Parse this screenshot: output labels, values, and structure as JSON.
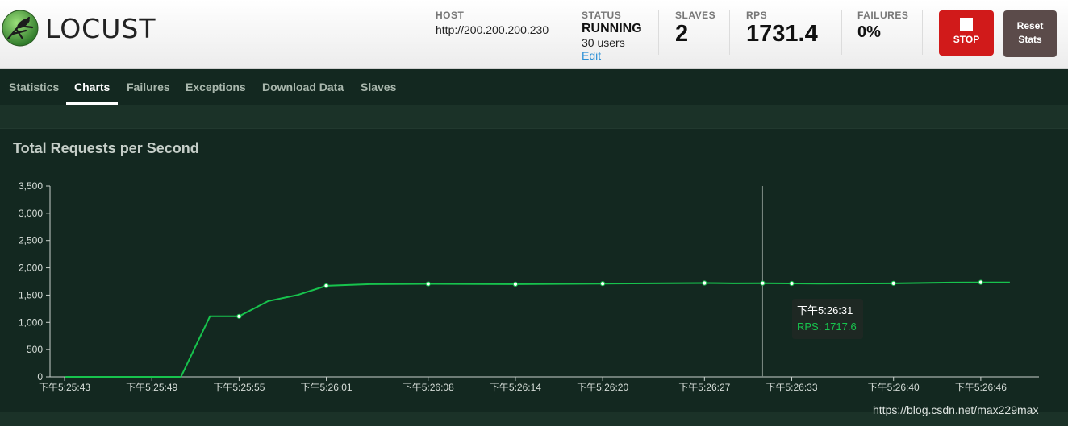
{
  "header": {
    "logo_text": "LOCUST",
    "host": {
      "label": "HOST",
      "value": "http://200.200.200.230"
    },
    "status": {
      "label": "STATUS",
      "value": "RUNNING",
      "users": "30 users",
      "edit": "Edit"
    },
    "slaves": {
      "label": "SLAVES",
      "value": "2"
    },
    "rps": {
      "label": "RPS",
      "value": "1731.4"
    },
    "failures": {
      "label": "FAILURES",
      "value": "0%"
    },
    "stop_label": "STOP",
    "reset_line1": "Reset",
    "reset_line2": "Stats"
  },
  "tabs": [
    "Statistics",
    "Charts",
    "Failures",
    "Exceptions",
    "Download Data",
    "Slaves"
  ],
  "active_tab": "Charts",
  "chart_data": {
    "type": "line",
    "title": "Total Requests per Second",
    "xlabel": "",
    "ylabel": "",
    "ylim": [
      0,
      3500
    ],
    "y_ticks": [
      0,
      500,
      1000,
      1500,
      2000,
      2500,
      3000,
      3500
    ],
    "y_tick_labels": [
      "0",
      "500",
      "1,000",
      "1,500",
      "2,000",
      "2,500",
      "3,000",
      "3,500"
    ],
    "x_tick_labels": [
      "下午5:25:43",
      "下午5:25:49",
      "下午5:25:55",
      "下午5:26:01",
      "下午5:26:08",
      "下午5:26:14",
      "下午5:26:20",
      "下午5:26:27",
      "下午5:26:33",
      "下午5:26:40",
      "下午5:26:46"
    ],
    "x_range": [
      "5:25:42",
      "5:26:50"
    ],
    "series": [
      {
        "name": "RPS",
        "color": "#17c34d",
        "points": [
          [
            "5:25:43",
            0
          ],
          [
            "5:25:46",
            0
          ],
          [
            "5:25:49",
            0
          ],
          [
            "5:25:51",
            0
          ],
          [
            "5:25:53",
            1110
          ],
          [
            "5:25:55",
            1110
          ],
          [
            "5:25:57",
            1390
          ],
          [
            "5:25:59",
            1500
          ],
          [
            "5:26:01",
            1670
          ],
          [
            "5:26:04",
            1700
          ],
          [
            "5:26:08",
            1705
          ],
          [
            "5:26:14",
            1700
          ],
          [
            "5:26:20",
            1710
          ],
          [
            "5:26:27",
            1720
          ],
          [
            "5:26:29",
            1714
          ],
          [
            "5:26:31",
            1717.6
          ],
          [
            "5:26:35",
            1708
          ],
          [
            "5:26:40",
            1715
          ],
          [
            "5:26:44",
            1730
          ],
          [
            "5:26:46",
            1733
          ],
          [
            "5:26:48",
            1731
          ]
        ],
        "markers": [
          "5:25:55",
          "5:26:01",
          "5:26:08",
          "5:26:14",
          "5:26:20",
          "5:26:27",
          "5:26:31",
          "5:26:33",
          "5:26:40",
          "5:26:46"
        ]
      }
    ],
    "hover": {
      "x": "5:26:31",
      "time_label": "下午5:26:31",
      "value_label": "RPS: 1717.6"
    }
  },
  "watermark": "https://blog.csdn.net/max229max"
}
